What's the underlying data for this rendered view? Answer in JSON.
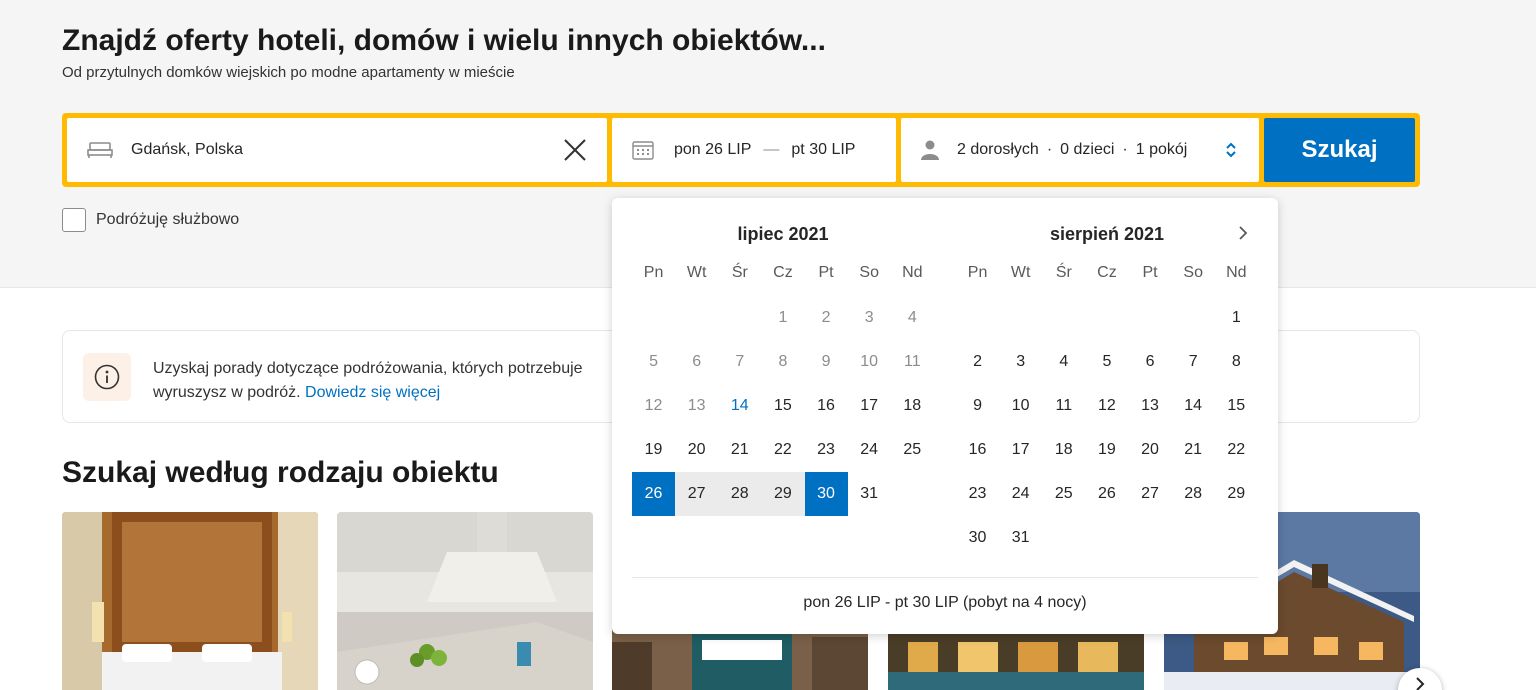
{
  "hero": {
    "title": "Znajdź oferty hoteli, domów i wielu innych obiektów...",
    "subtitle": "Od przytulnych domków wiejskich po modne apartamenty w mieście"
  },
  "search": {
    "destination_value": "Gdańsk, Polska",
    "date_checkin": "pon 26 LIP",
    "date_separator": "—",
    "date_checkout": "pt 30 LIP",
    "guests_adults": "2 dorosłych",
    "guests_children": "0 dzieci",
    "guests_rooms": "1 pokój",
    "guests_separator": "·",
    "button_label": "Szukaj"
  },
  "business_travel": {
    "label": "Podróżuję służbowo",
    "checked": false
  },
  "info_banner": {
    "text": "Uzyskaj porady dotyczące podróżowania, których potrzebuje",
    "text_2": "wyruszysz w podróż.",
    "link_label": "Dowiedz się więcej"
  },
  "section": {
    "title": "Szukaj według rodzaju obiektu"
  },
  "calendar": {
    "weekdays": [
      "Pn",
      "Wt",
      "Śr",
      "Cz",
      "Pt",
      "So",
      "Nd"
    ],
    "months": [
      {
        "title": "lipiec 2021",
        "offset": 3,
        "days": 31,
        "past_until": 13,
        "today": 14,
        "selected_start": 26,
        "selected_end": 30
      },
      {
        "title": "sierpień 2021",
        "offset": 6,
        "days": 31
      }
    ],
    "footer": "pon 26 LIP - pt 30 LIP (pobyt na 4 nocy)"
  },
  "colors": {
    "accent": "#febb02",
    "primary": "#0071c2",
    "hero_bg": "#f5f5f5"
  },
  "icons": {
    "destination": "bed-icon",
    "clear": "close-icon",
    "dates": "calendar-icon",
    "guests": "person-icon",
    "guests_toggle": "chevron-updown-icon",
    "info": "info-icon",
    "calendar_next": "chevron-right-icon",
    "carousel_next": "chevron-right-icon"
  },
  "property_types": [
    {
      "name": "property-card-hotel"
    },
    {
      "name": "property-card-apartment"
    },
    {
      "name": "property-card-resort"
    },
    {
      "name": "property-card-villa"
    },
    {
      "name": "property-card-chalet"
    }
  ]
}
